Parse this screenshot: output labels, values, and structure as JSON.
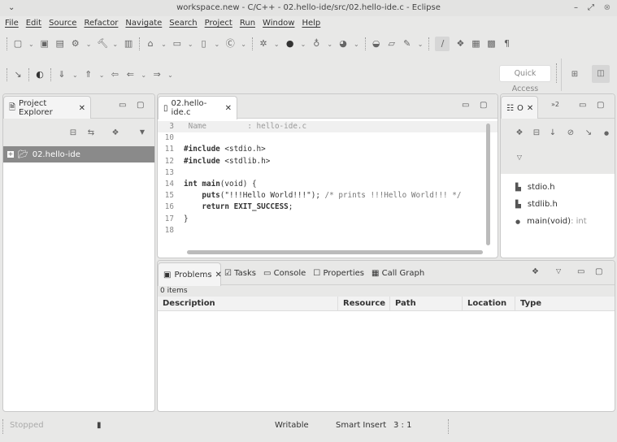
{
  "window": {
    "title": "workspace.new - C/C++ - 02.hello-ide/src/02.hello-ide.c - Eclipse"
  },
  "menu": [
    "File",
    "Edit",
    "Source",
    "Refactor",
    "Navigate",
    "Search",
    "Project",
    "Run",
    "Window",
    "Help"
  ],
  "toolbar": {
    "quick_access": "Quick Access"
  },
  "project_explorer": {
    "title": "Project Explorer",
    "items": [
      {
        "label": "02.hello-ide",
        "selected": true
      }
    ]
  },
  "editor": {
    "tab": "02.hello-ide.c",
    "lines": [
      {
        "n": "3",
        "text": " Name         : hello-ide.c"
      },
      {
        "n": "10",
        "text": ""
      },
      {
        "n": "11",
        "text": "#include <stdio.h>"
      },
      {
        "n": "12",
        "text": "#include <stdlib.h>"
      },
      {
        "n": "13",
        "text": ""
      },
      {
        "n": "14",
        "text": "int main(void) {"
      },
      {
        "n": "15",
        "text": "    puts(\"!!!Hello World!!!\"); /* prints !!!Hello World!!! */"
      },
      {
        "n": "16",
        "text": "    return EXIT_SUCCESS;"
      },
      {
        "n": "17",
        "text": "}"
      },
      {
        "n": "18",
        "text": ""
      }
    ]
  },
  "outline": {
    "tab": "O",
    "tab2": "»2",
    "items": [
      {
        "label": "stdio.h",
        "icon": "include-icon"
      },
      {
        "label": "stdlib.h",
        "icon": "include-icon"
      },
      {
        "label": "main(void)",
        "type": " : int",
        "icon": "function-icon"
      }
    ]
  },
  "bottom": {
    "tabs": [
      "Problems",
      "Tasks",
      "Console",
      "Properties",
      "Call Graph"
    ],
    "count": "0 items",
    "columns": [
      "Description",
      "Resource",
      "Path",
      "Location",
      "Type"
    ]
  },
  "status": {
    "state": "Stopped",
    "writable": "Writable",
    "insert": "Smart Insert",
    "position": "3 : 1"
  }
}
